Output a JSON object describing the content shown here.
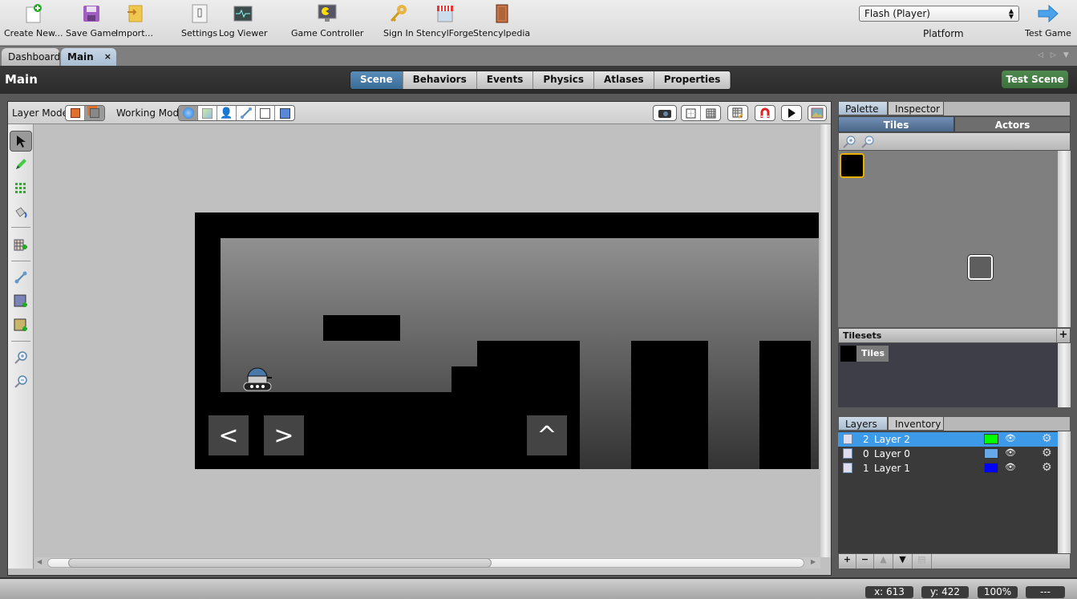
{
  "toolbar": {
    "items": [
      {
        "label": "Create New...",
        "icon": "create-new-icon"
      },
      {
        "label": "Save Game",
        "icon": "save-icon"
      },
      {
        "label": "Import...",
        "icon": "import-icon"
      },
      {
        "label": "Settings",
        "icon": "settings-switch-icon"
      },
      {
        "label": "Log Viewer",
        "icon": "log-viewer-icon"
      },
      {
        "label": "Game Controller",
        "icon": "game-controller-icon"
      },
      {
        "label": "Sign In",
        "icon": "key-icon"
      },
      {
        "label": "StencylForge",
        "icon": "store-icon"
      },
      {
        "label": "Stencylpedia",
        "icon": "book-icon"
      }
    ],
    "platform_value": "Flash (Player)",
    "platform_label": "Platform",
    "test_game_label": "Test Game"
  },
  "doc_tabs": [
    {
      "label": "Dashboard",
      "active": false
    },
    {
      "label": "Main",
      "active": true,
      "close": "×"
    }
  ],
  "header": {
    "title": "Main",
    "tabs": [
      "Scene",
      "Behaviors",
      "Events",
      "Physics",
      "Atlases",
      "Properties"
    ],
    "active_tab": "Scene",
    "test_scene_label": "Test Scene"
  },
  "mode_bar": {
    "layer_mode_label": "Layer Mode",
    "working_mode_label": "Working Mode"
  },
  "scene": {
    "controls": [
      "<",
      ">",
      "^"
    ]
  },
  "right_panel": {
    "top_tabs": [
      "Palette",
      "Inspector"
    ],
    "sub_tabs": [
      "Tiles",
      "Actors"
    ],
    "tilesets_label": "Tilesets",
    "tileset_name": "Tiles",
    "bottom_tabs": [
      "Layers",
      "Inventory"
    ],
    "layers": [
      {
        "order": "2",
        "name": "Layer 2",
        "color": "#00ff00",
        "selected": true
      },
      {
        "order": "0",
        "name": "Layer 0",
        "color": "#66a8e8",
        "selected": false
      },
      {
        "order": "1",
        "name": "Layer 1",
        "color": "#0000ff",
        "selected": false
      }
    ]
  },
  "status": {
    "x": "x:   613",
    "y": "y:   422",
    "zoom": "100%",
    "extra": "---"
  }
}
